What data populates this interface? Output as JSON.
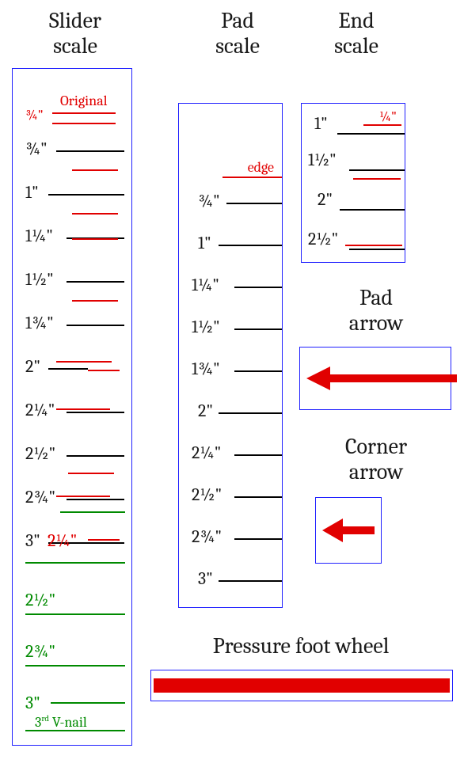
{
  "titles": {
    "slider": "Slider\nscale",
    "pad": "Pad\nscale",
    "end": "End\nscale",
    "pad_arrow": "Pad\narrow",
    "corner_arrow": "Corner\narrow",
    "pfw": "Pressure foot wheel"
  },
  "slider": {
    "original_label": "Original",
    "original_frac": "¾\"",
    "black": [
      "¾\"",
      "1\"",
      "1¼\"",
      "1½\"",
      "1¾\"",
      "2\"",
      "2¼\"",
      "2½\"",
      "2¾\"",
      "3\""
    ],
    "red_override_at_3": "2¼\"",
    "green": [
      "2½\"",
      "2¾\"",
      "3\""
    ],
    "vnail_label": "3rd V-nail"
  },
  "pad": {
    "edge_label": "edge",
    "ticks": [
      "¾\"",
      "1\"",
      "1¼\"",
      "1½\"",
      "1¾\"",
      "2\"",
      "2¼\"",
      "2½\"",
      "2¾\"",
      "3\""
    ]
  },
  "end": {
    "top_red_label": "¼\"",
    "ticks": [
      "1\"",
      "1½\"",
      "2\"",
      "2½\""
    ]
  }
}
